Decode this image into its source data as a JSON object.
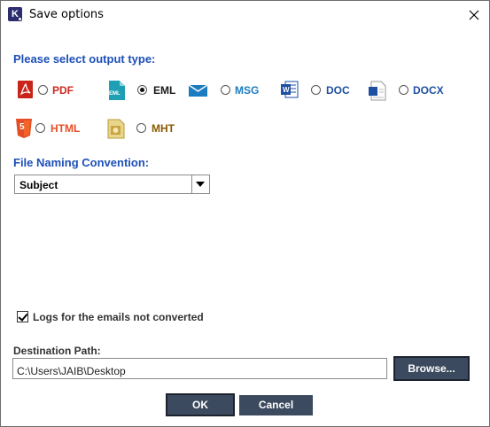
{
  "window": {
    "title": "Save options",
    "app_icon_letter": "K"
  },
  "output_type": {
    "heading": "Please select output type:",
    "selected": "EML",
    "options": [
      {
        "id": "pdf",
        "label": "PDF",
        "icon": "pdf-file-icon",
        "color": "#cc2a1e",
        "checked": false
      },
      {
        "id": "eml",
        "label": "EML",
        "icon": "eml-file-icon",
        "color": "#1a1a1a",
        "checked": true
      },
      {
        "id": "msg",
        "label": "MSG",
        "icon": "envelope-icon",
        "color": "#1b7cc0",
        "checked": false
      },
      {
        "id": "doc",
        "label": "DOC",
        "icon": "word-doc-icon",
        "color": "#1d4fa3",
        "checked": false
      },
      {
        "id": "docx",
        "label": "DOCX",
        "icon": "word-docx-icon",
        "color": "#1d4fa3",
        "checked": false
      },
      {
        "id": "html",
        "label": "HTML",
        "icon": "html5-icon",
        "color": "#e44d26",
        "checked": false
      },
      {
        "id": "mht",
        "label": "MHT",
        "icon": "mht-file-icon",
        "color": "#8a5a00",
        "checked": false
      }
    ],
    "icon_badges": {
      "eml": "EML",
      "html": "5",
      "doc": "W"
    }
  },
  "naming": {
    "heading": "File Naming Convention:",
    "selected_value": "Subject"
  },
  "logs_checkbox": {
    "label": "Logs for the emails not converted",
    "checked": true
  },
  "destination": {
    "label": "Destination Path:",
    "value": "C:\\Users\\JAIB\\Desktop",
    "browse_label": "Browse..."
  },
  "buttons": {
    "ok_label": "OK",
    "cancel_label": "Cancel"
  },
  "colors": {
    "heading_blue": "#1c4fb8",
    "button_bg": "#3b4a5e"
  }
}
